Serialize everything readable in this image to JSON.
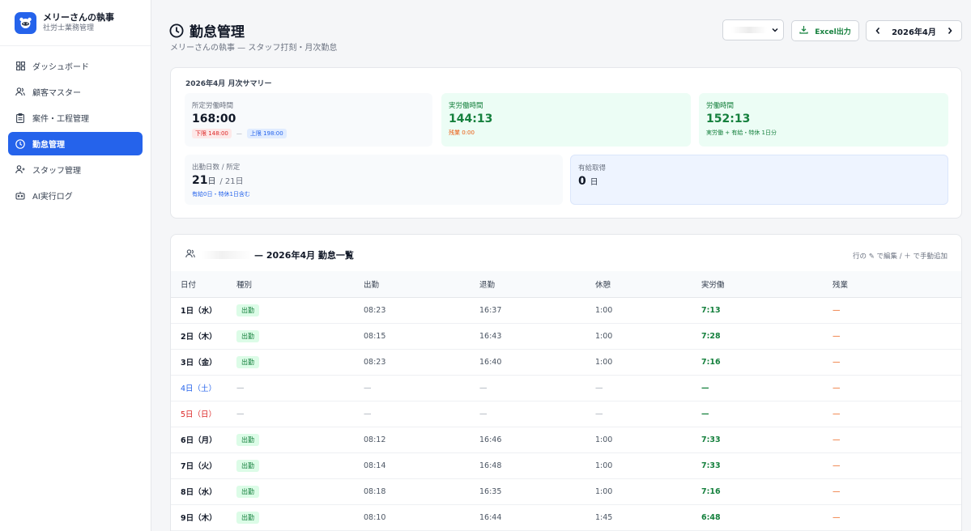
{
  "app": {
    "name": "メリーさんの執事",
    "subtitle": "社労士業務管理"
  },
  "nav": [
    {
      "label": "ダッシュボード",
      "icon": "grid-icon",
      "active": false
    },
    {
      "label": "顧客マスター",
      "icon": "users-icon",
      "active": false
    },
    {
      "label": "案件・工程管理",
      "icon": "clipboard-icon",
      "active": false
    },
    {
      "label": "勤怠管理",
      "icon": "clock-icon",
      "active": true
    },
    {
      "label": "スタッフ管理",
      "icon": "user-plus-icon",
      "active": false
    },
    {
      "label": "AI実行ログ",
      "icon": "robot-icon",
      "active": false
    }
  ],
  "header": {
    "title": "勤怠管理",
    "subtitle": "メリーさんの執事 — スタッフ打刻・月次勤怠",
    "excel_label": "Excel出力",
    "month": "2026年4月"
  },
  "summary": {
    "title": "2026年4月 月次サマリー",
    "scheduled": {
      "label": "所定労働時間",
      "value": "168:00",
      "lower": "下限 148:00",
      "sep": "—",
      "upper": "上限 198:00"
    },
    "actual": {
      "label": "実労働時間",
      "value": "144:13",
      "note": "残業 0:00"
    },
    "labor": {
      "label": "労働時間",
      "value": "152:13",
      "note": "実労働 + 有給・特休 1日分"
    },
    "days": {
      "label": "出勤日数 / 所定",
      "value": "21",
      "unit": "日",
      "rest": "/ 21日",
      "note": "有給0日・特休1日含む"
    },
    "paid_leave": {
      "label": "有給取得",
      "value": "0",
      "unit": "日"
    }
  },
  "list": {
    "title": "— 2026年4月 勤怠一覧",
    "hint": "行の ✎ で編集 / ＋ で手動追加",
    "columns": [
      "日付",
      "種別",
      "出勤",
      "退勤",
      "休憩",
      "実労働",
      "残業"
    ],
    "rows": [
      {
        "date": "1日（水）",
        "type": "出勤",
        "in": "08:23",
        "out": "16:37",
        "break": "1:00",
        "work": "7:13",
        "ot": "—",
        "day": "weekday"
      },
      {
        "date": "2日（木）",
        "type": "出勤",
        "in": "08:15",
        "out": "16:43",
        "break": "1:00",
        "work": "7:28",
        "ot": "—",
        "day": "weekday"
      },
      {
        "date": "3日（金）",
        "type": "出勤",
        "in": "08:23",
        "out": "16:40",
        "break": "1:00",
        "work": "7:16",
        "ot": "—",
        "day": "weekday"
      },
      {
        "date": "4日（土）",
        "type": "—",
        "in": "—",
        "out": "—",
        "break": "—",
        "work": "—",
        "ot": "—",
        "day": "sat"
      },
      {
        "date": "5日（日）",
        "type": "—",
        "in": "—",
        "out": "—",
        "break": "—",
        "work": "—",
        "ot": "—",
        "day": "sun"
      },
      {
        "date": "6日（月）",
        "type": "出勤",
        "in": "08:12",
        "out": "16:46",
        "break": "1:00",
        "work": "7:33",
        "ot": "—",
        "day": "weekday"
      },
      {
        "date": "7日（火）",
        "type": "出勤",
        "in": "08:14",
        "out": "16:48",
        "break": "1:00",
        "work": "7:33",
        "ot": "—",
        "day": "weekday"
      },
      {
        "date": "8日（水）",
        "type": "出勤",
        "in": "08:18",
        "out": "16:35",
        "break": "1:00",
        "work": "7:16",
        "ot": "—",
        "day": "weekday"
      },
      {
        "date": "9日（木）",
        "type": "出勤",
        "in": "08:10",
        "out": "16:44",
        "break": "1:45",
        "work": "6:48",
        "ot": "—",
        "day": "weekday"
      }
    ]
  }
}
